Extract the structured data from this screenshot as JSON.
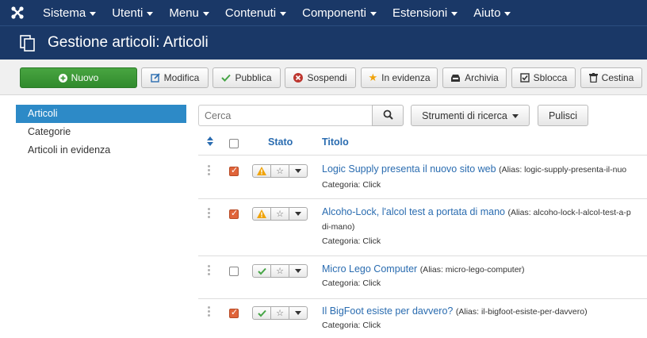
{
  "nav": {
    "items": [
      {
        "label": "Sistema"
      },
      {
        "label": "Utenti"
      },
      {
        "label": "Menu"
      },
      {
        "label": "Contenuti"
      },
      {
        "label": "Componenti"
      },
      {
        "label": "Estensioni"
      },
      {
        "label": "Aiuto"
      }
    ]
  },
  "header": {
    "title": "Gestione articoli: Articoli"
  },
  "toolbar": {
    "new_label": "Nuovo",
    "edit_label": "Modifica",
    "publish_label": "Pubblica",
    "unpublish_label": "Sospendi",
    "feature_label": "In evidenza",
    "archive_label": "Archivia",
    "checkin_label": "Sblocca",
    "trash_label": "Cestina"
  },
  "sidebar": {
    "items": [
      {
        "label": "Articoli",
        "active": true
      },
      {
        "label": "Categorie",
        "active": false
      },
      {
        "label": "Articoli in evidenza",
        "active": false
      }
    ]
  },
  "search": {
    "placeholder": "Cerca",
    "tools_label": "Strumenti di ricerca",
    "clear_label": "Pulisci"
  },
  "table": {
    "col_status": "Stato",
    "col_title": "Titolo",
    "rows": [
      {
        "title": "Logic Supply presenta il nuovo sito web",
        "alias": "(Alias: logic-supply-presenta-il-nuo",
        "alias_cont": "",
        "category": "Categoria: Click",
        "checked": true,
        "status": "warning"
      },
      {
        "title": "Alcoho-Lock, l'alcol test a portata di mano",
        "alias": "(Alias: alcoho-lock-l-alcol-test-a-p",
        "alias_cont": "di-mano)",
        "category": "Categoria: Click",
        "checked": true,
        "status": "warning"
      },
      {
        "title": "Micro Lego Computer",
        "alias": "(Alias: micro-lego-computer)",
        "alias_cont": "",
        "category": "Categoria: Click",
        "checked": false,
        "status": "published"
      },
      {
        "title": "Il BigFoot esiste per davvero?",
        "alias": "(Alias: il-bigfoot-esiste-per-davvero)",
        "alias_cont": "",
        "category": "Categoria: Click",
        "checked": true,
        "status": "published"
      }
    ]
  },
  "colors": {
    "navbar": "#1a3867",
    "primary_green": "#3f9a39",
    "active_blue": "#2d8ac7",
    "link_blue": "#2a6cb0",
    "checked_orange": "#e0643a",
    "warning_orange": "#f0a30a",
    "published_green": "#46a546"
  }
}
